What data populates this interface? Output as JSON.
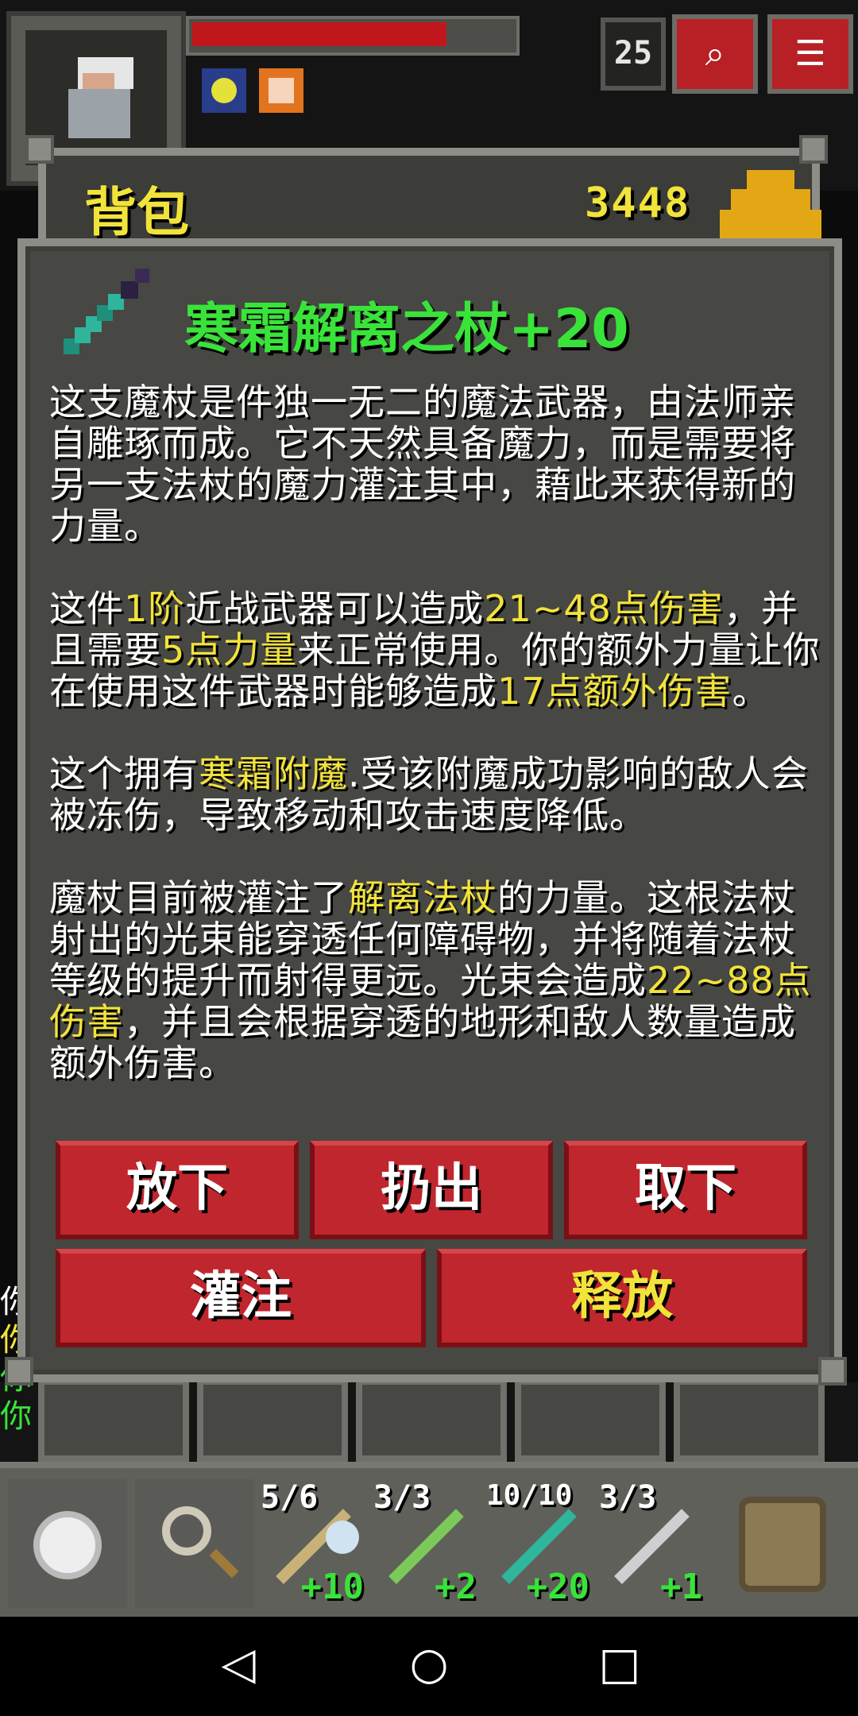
{
  "depth": "25",
  "inventory_title": "背包",
  "gold": "3448",
  "item": {
    "name": "寒霜解离之杖+20",
    "para1": "这支魔杖是件独一无二的魔法武器，由法师亲自雕琢而成。它不天然具备魔力，而是需要将另一支法杖的魔力灌注其中，藉此来获得新的力量。",
    "para2": {
      "a": "这件",
      "b": "1阶",
      "c": "近战武器可以造成",
      "d": "21~48点伤害",
      "e": "，并且需要",
      "f": "5点力量",
      "g": "来正常使用。你的额外力量让你在使用这件武器时能够造成",
      "h": "17点额外伤害",
      "i": "。"
    },
    "para3": {
      "a": "这个拥有",
      "b": "寒霜附魔",
      "c": ".受该附魔成功影响的敌人会被冻伤，导致移动和攻击速度降低。"
    },
    "para4": {
      "a": "魔杖目前被灌注了",
      "b": "解离法杖",
      "c": "的力量。这根法杖射出的光束能穿透任何障碍物，并将随着法杖等级的提升而射得更远。光束会造成",
      "d": "22~88点伤害",
      "e": "，并且会根据穿透的地形和敌人数量造成额外伤害。"
    }
  },
  "actions": {
    "drop": "放下",
    "throw": "扔出",
    "unequip": "取下",
    "imbue": "灌注",
    "release": "释放"
  },
  "log": [
    "你",
    "你",
    "你",
    "你"
  ],
  "quickslots": [
    {
      "charge": "5/6",
      "level": "+10"
    },
    {
      "charge": "3/3",
      "level": "+2"
    },
    {
      "charge": "10/10",
      "level": "+20"
    },
    {
      "charge": "3/3",
      "level": "+1"
    }
  ],
  "colors": {
    "highlight": "#f2e33b",
    "title_green": "#39e33a",
    "button_red": "#c0262d",
    "hp_red": "#c0171c"
  },
  "icons": [
    "journal-icon",
    "menu-icon",
    "clock-icon",
    "search-icon",
    "backpack-icon",
    "wand-icon",
    "gold-icon",
    "back-nav-icon",
    "home-nav-icon",
    "recents-nav-icon"
  ]
}
